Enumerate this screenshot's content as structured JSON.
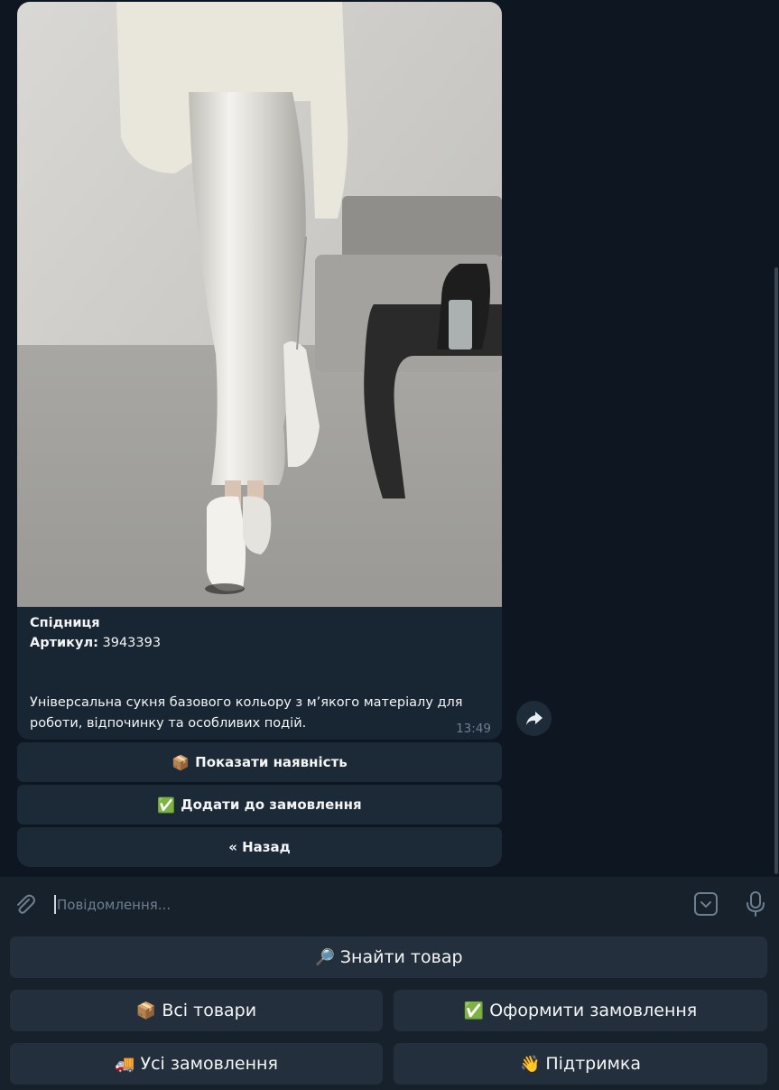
{
  "message": {
    "title": "Спідниця",
    "sku_label": "Артикул:",
    "sku_value": "3943393",
    "description": "Універсальна сукня базового кольору з м’якого матеріалу для роботи, відпочинку та особливих подій.",
    "time": "13:49"
  },
  "inline_buttons": [
    {
      "emoji": "📦",
      "label": "Показати наявність"
    },
    {
      "emoji": "✅",
      "label": "Додати до замовлення"
    },
    {
      "emoji": "",
      "label": "« Назад"
    }
  ],
  "composer": {
    "placeholder": "Повідомлення..."
  },
  "keyboard": {
    "find": {
      "emoji": "🔎",
      "label": "Знайти товар"
    },
    "all_products": {
      "emoji": "📦",
      "label": "Всі товари"
    },
    "checkout": {
      "emoji": "✅",
      "label": "Оформити замовлення"
    },
    "all_orders": {
      "emoji": "🚚",
      "label": "Усі замовлення"
    },
    "support": {
      "emoji": "👋",
      "label": "Підтримка"
    }
  },
  "icons": {
    "attach": "paperclip-icon",
    "keyboard_toggle": "keyboard-toggle-icon",
    "mic": "microphone-icon",
    "share": "share-arrow-icon"
  },
  "colors": {
    "background": "#0e1621",
    "bubble": "#182533",
    "button": "#232f3c",
    "muted_text": "#6d7f8f"
  }
}
